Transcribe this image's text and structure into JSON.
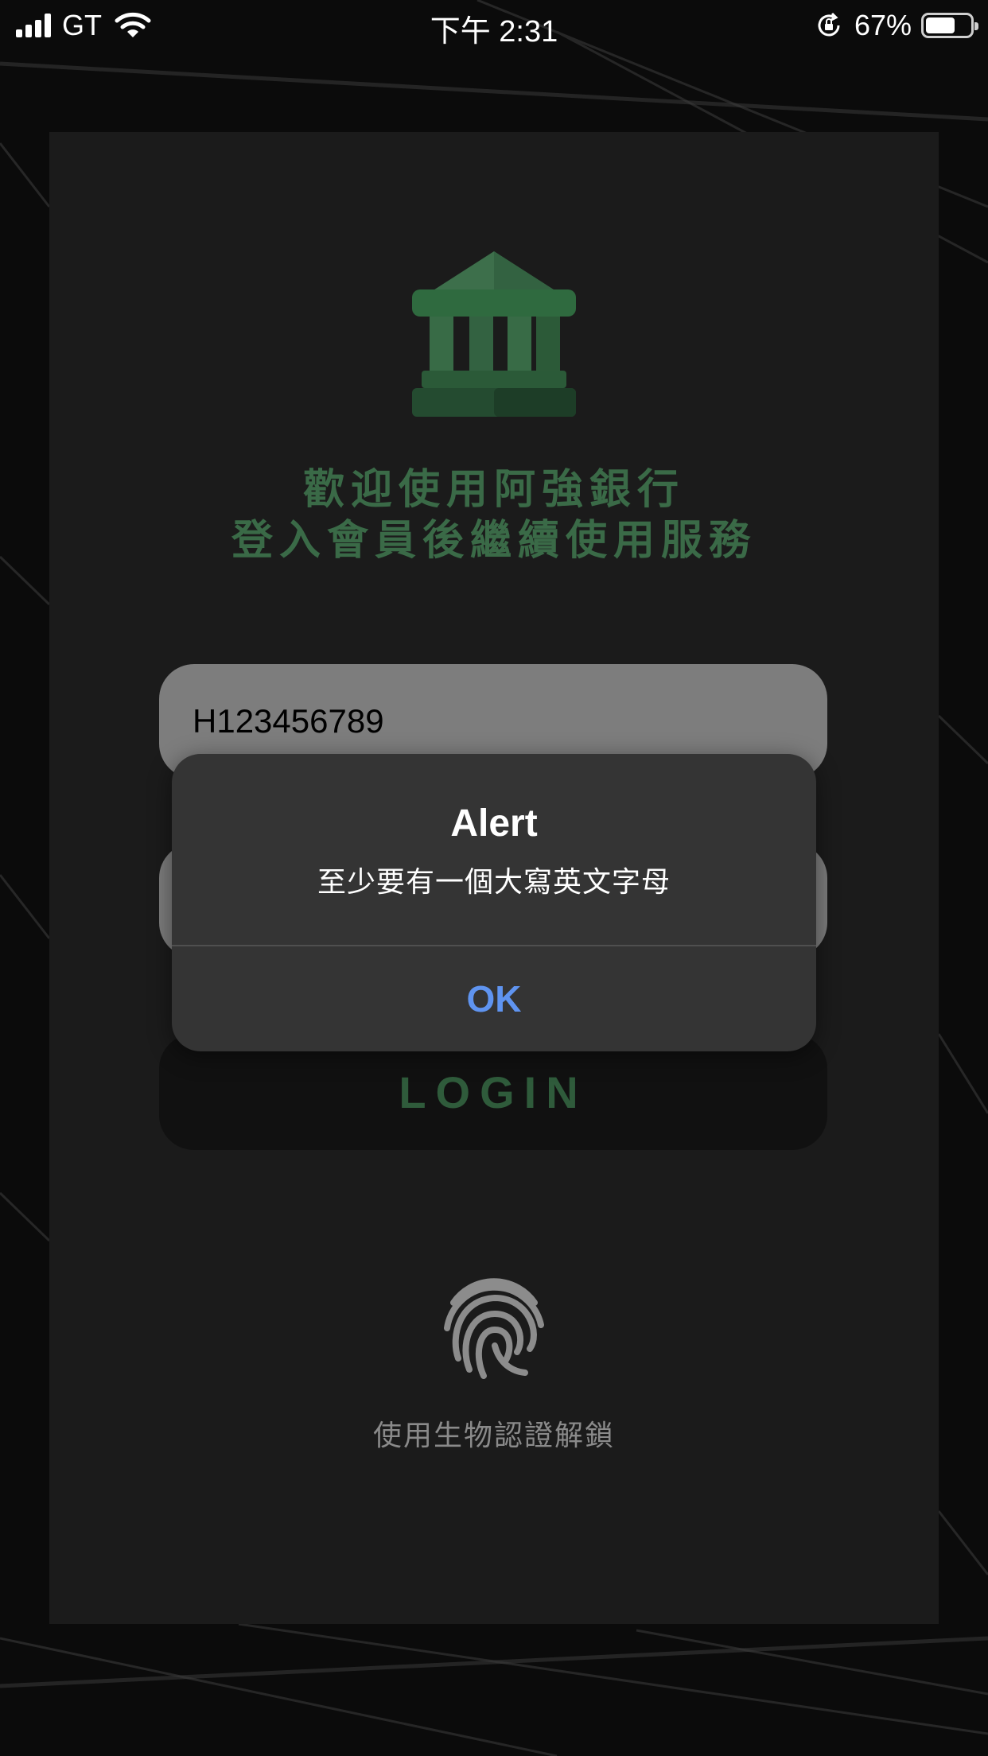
{
  "status_bar": {
    "carrier": "GT",
    "time": "下午 2:31",
    "battery_percent": "67%",
    "battery_level": 0.67,
    "icons": [
      "signal-icon",
      "wifi-icon",
      "rotation-lock-icon",
      "battery-icon"
    ]
  },
  "login": {
    "bank_icon": "bank-building-icon",
    "welcome_line1": "歡迎使用阿強銀行",
    "welcome_line2": "登入會員後繼續使用服務",
    "id_value": "H123456789",
    "login_button": "LOGIN",
    "biometric_icon": "fingerprint-icon",
    "biometric_label": "使用生物認證解鎖"
  },
  "alert": {
    "title": "Alert",
    "message": "至少要有一個大寫英文字母",
    "ok_label": "OK"
  },
  "colors": {
    "accent_green": "#3a6a47",
    "alert_ok_blue": "#5f94f0",
    "card_background": "#1b1b1b",
    "input_background": "#7d7d7d"
  }
}
